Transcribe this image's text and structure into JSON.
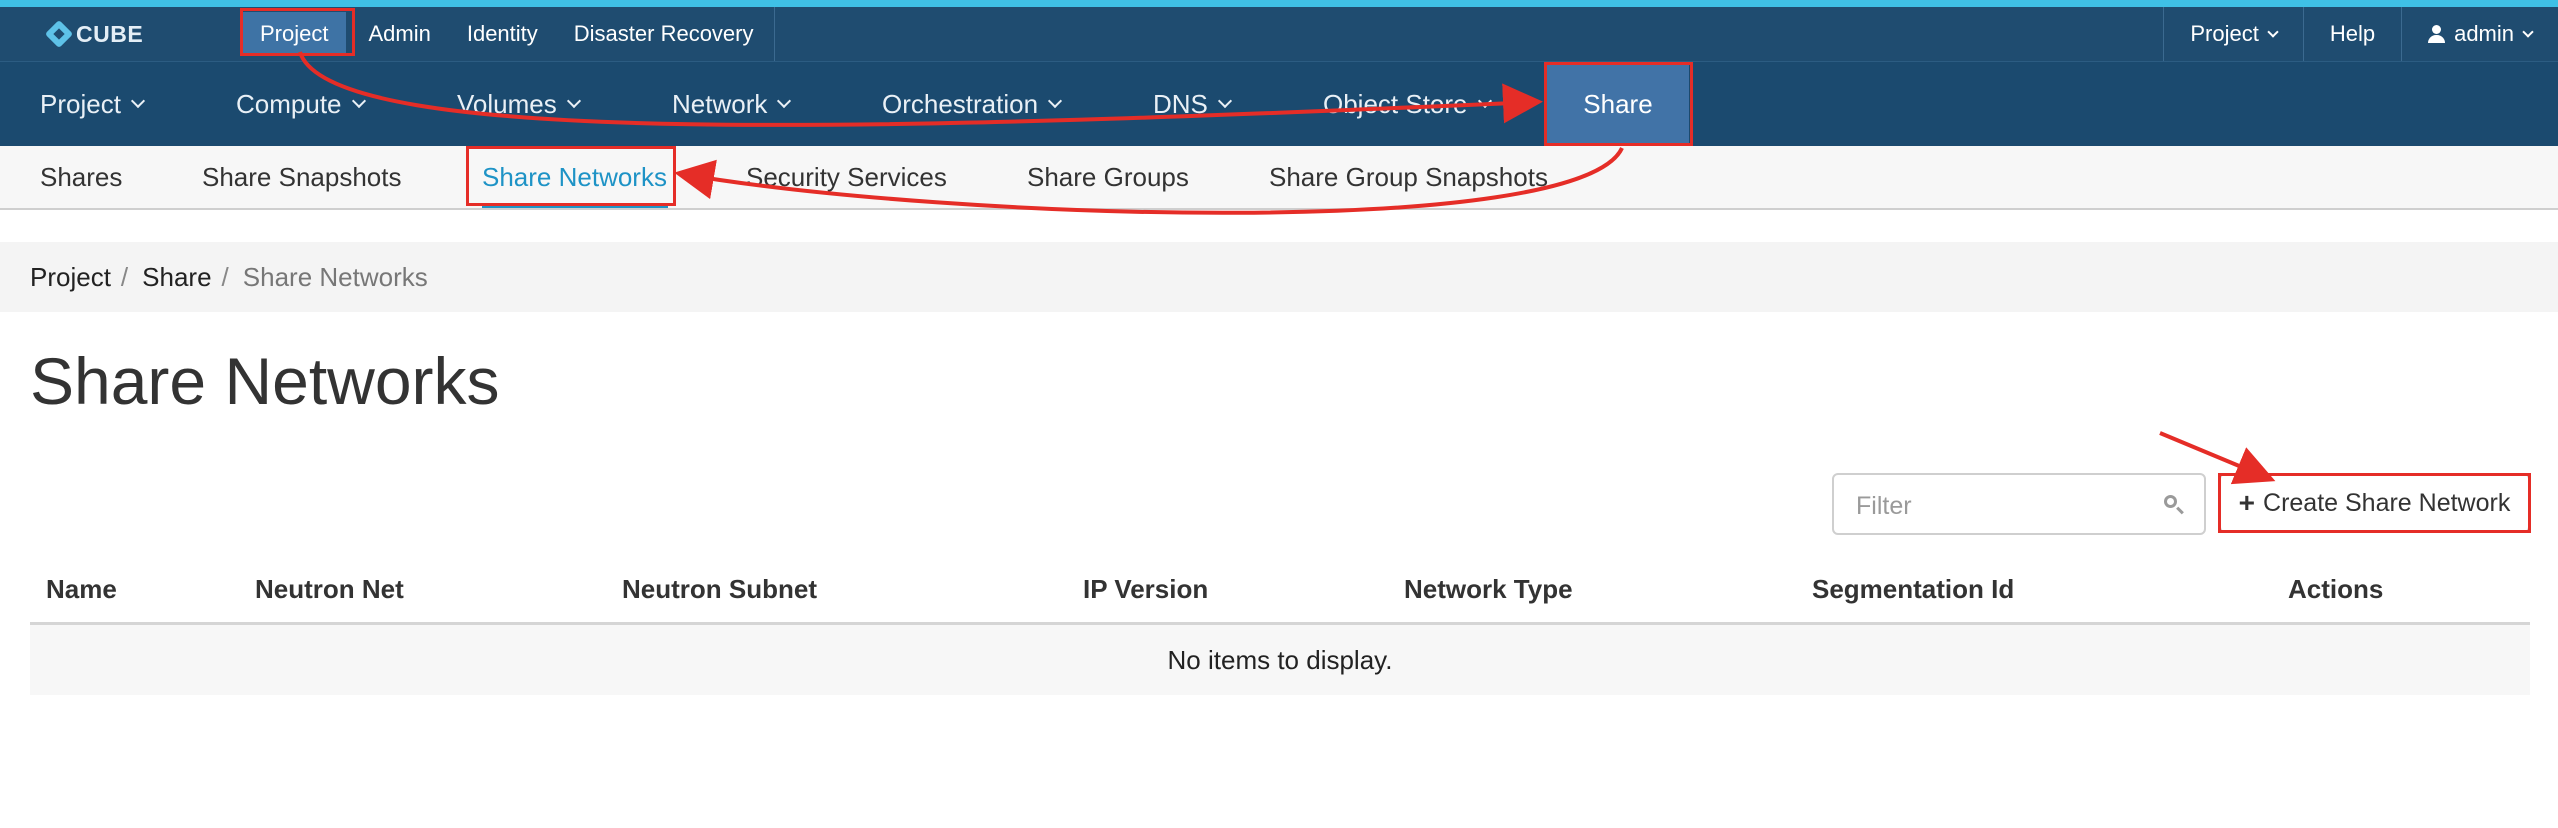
{
  "top_bar": {
    "brand": "CUBE",
    "nav": [
      "Project",
      "Admin",
      "Identity",
      "Disaster Recovery"
    ],
    "active_nav": "Project",
    "project_menu": "Project",
    "help": "Help",
    "user": "admin"
  },
  "main_nav": {
    "items": [
      "Project",
      "Compute",
      "Volumes",
      "Network",
      "Orchestration",
      "DNS",
      "Object Store",
      "Share"
    ],
    "active": "Share"
  },
  "sub_nav": {
    "items": [
      "Shares",
      "Share Snapshots",
      "Share Networks",
      "Security Services",
      "Share Groups",
      "Share Group Snapshots"
    ],
    "active": "Share Networks"
  },
  "breadcrumb": [
    "Project",
    "Share",
    "Share Networks"
  ],
  "page_title": "Share Networks",
  "filter": {
    "placeholder": "Filter",
    "value": ""
  },
  "create_button": "Create Share Network",
  "table": {
    "columns": [
      "Name",
      "Neutron Net",
      "Neutron Subnet",
      "IP Version",
      "Network Type",
      "Segmentation Id",
      "Actions"
    ],
    "empty_message": "No items to display."
  },
  "colors": {
    "topbar_bg": "#1f4c70",
    "mainnav_bg": "#1b4a6f",
    "active_bg": "#4173a7",
    "accent_strip": "#3fc0e6",
    "link_active": "#1e93c6",
    "annotation_red": "#e52d27"
  }
}
